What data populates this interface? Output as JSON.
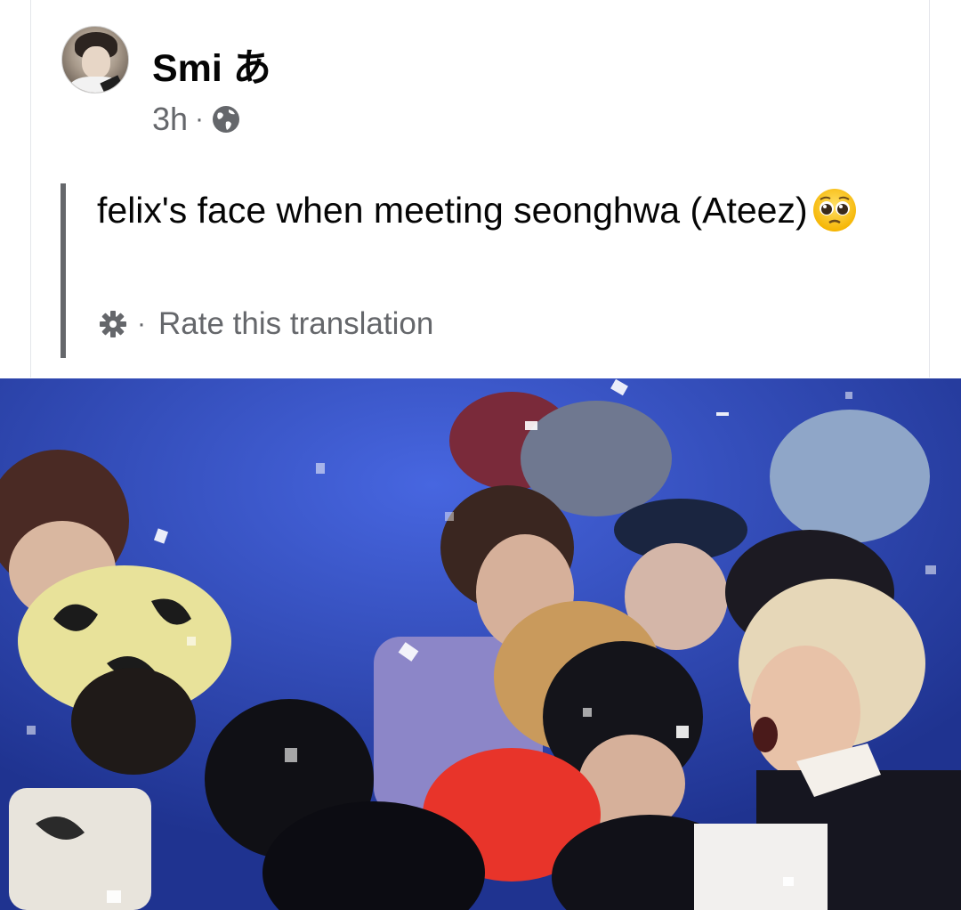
{
  "post": {
    "author_name": "Smi あ",
    "timestamp": "3h",
    "separator": "·",
    "privacy_icon": "globe-icon",
    "text": "felix's face when meeting seonghwa (Ateez)",
    "emoji": "pleading-face-emoji",
    "translation": {
      "gear_icon": "gear-icon",
      "separator": "·",
      "rate_label": "Rate this translation"
    }
  },
  "photo": {
    "description_icon": "concert-photo"
  },
  "colors": {
    "text_primary": "#050505",
    "text_secondary": "#65676b",
    "quote_bar": "#65676b",
    "photo_background": "#3a55c8"
  }
}
